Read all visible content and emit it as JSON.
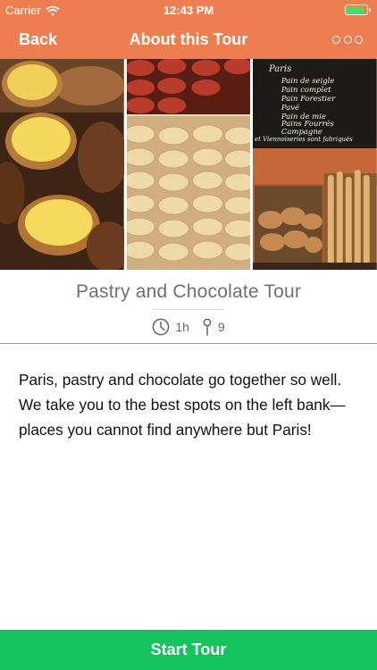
{
  "status": {
    "carrier": "Carrier",
    "time": "12:43 PM",
    "battery_level": 0.85
  },
  "nav": {
    "back_label": "Back",
    "title": "About this Tour"
  },
  "tour": {
    "title": "Pastry and Chocolate Tour",
    "duration": "1h",
    "stops": "9",
    "description": "Paris, pastry and chocolate go together so well. We take you to the best spots on the left bank— places you cannot find anywhere but Paris!",
    "chalkboard": {
      "sign": "Paris",
      "lines": [
        "Pain de seigle",
        "Pain complet",
        "Pain Forestier",
        "Pavé",
        "Pain de mie",
        "Pains Fourrés",
        "Campagne",
        "et Viennoiseries sont fabriqués"
      ]
    }
  },
  "colors": {
    "nav": "#ee7e50",
    "button": "#14c35f"
  },
  "icons": {
    "menu": "more-icon",
    "duration": "clock-icon",
    "stops": "pin-icon"
  },
  "action": {
    "start_label": "Start Tour"
  }
}
